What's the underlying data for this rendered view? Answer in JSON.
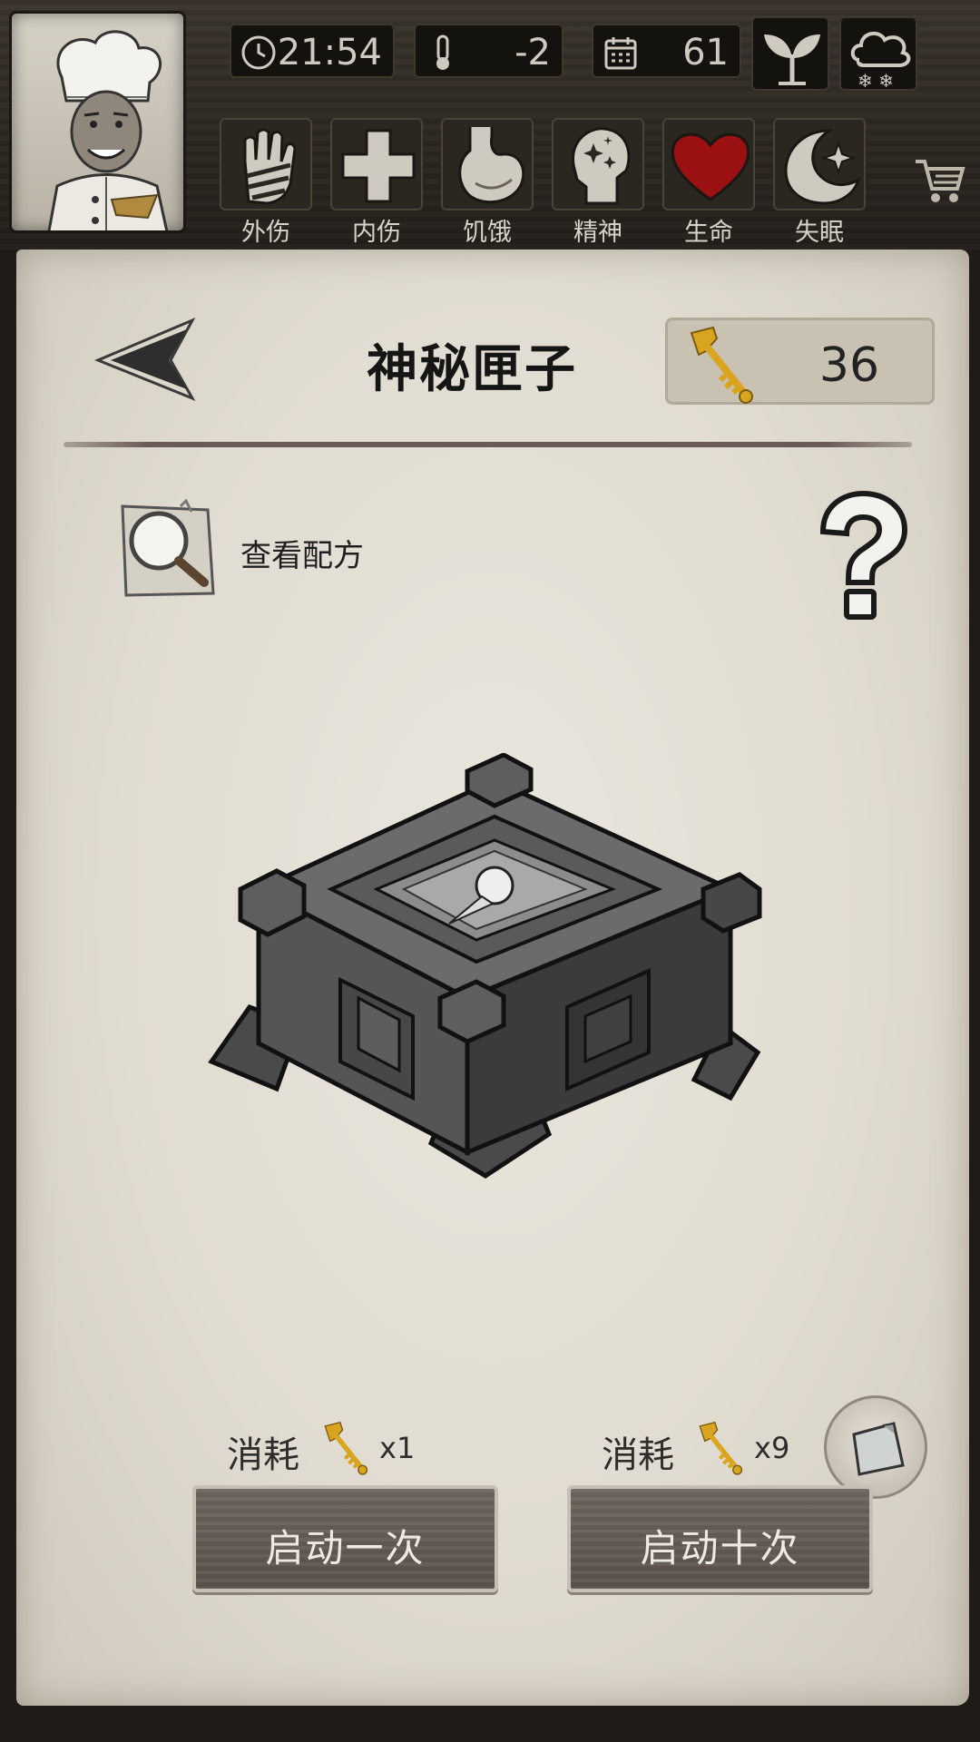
{
  "hud": {
    "time": "21:54",
    "temperature": "-2",
    "day": "61",
    "icons": {
      "time": "clock-icon",
      "temperature": "thermometer-icon",
      "day": "calendar-icon",
      "plant": "sprout-icon",
      "weather": "snow-cloud-icon",
      "shop": "shopping-cart-icon"
    },
    "statuses": [
      {
        "label": "外伤",
        "icon": "hand-bandage-icon"
      },
      {
        "label": "内伤",
        "icon": "cross-icon"
      },
      {
        "label": "饥饿",
        "icon": "stomach-icon"
      },
      {
        "label": "精神",
        "icon": "head-sparkle-icon"
      },
      {
        "label": "生命",
        "icon": "heart-icon",
        "color": "#9b1010"
      },
      {
        "label": "失眠",
        "icon": "moon-star-icon"
      }
    ]
  },
  "page": {
    "title": "神秘匣子",
    "key_count": "36",
    "recipe_label": "查看配方"
  },
  "actions": [
    {
      "cost_label": "消耗",
      "cost_qty": "x1",
      "button_label": "启动一次"
    },
    {
      "cost_label": "消耗",
      "cost_qty": "x9",
      "button_label": "启动十次"
    }
  ],
  "colors": {
    "key_gold": "#d9a521",
    "button": "#615952",
    "parchment": "#e3ded4"
  }
}
